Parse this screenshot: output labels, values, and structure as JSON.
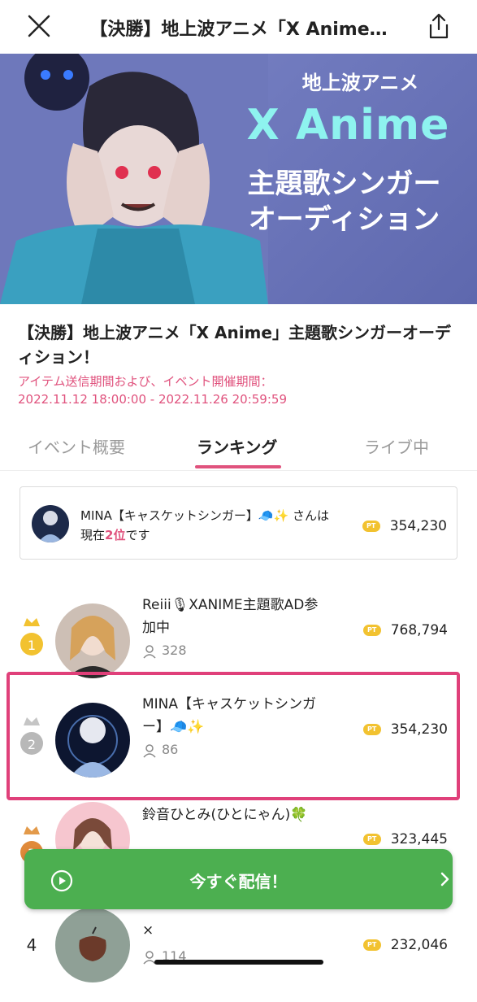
{
  "header": {
    "title": "【決勝】地上波アニメ「X Anime…"
  },
  "banner": {
    "line1": "地上波アニメ",
    "line2": "X Anime",
    "line3": "主題歌シンガー",
    "line4": "オーディション"
  },
  "event": {
    "title": "【決勝】地上波アニメ「X Anime」主題歌シンガーオーディション！",
    "period_label": "アイテム送信期間および、イベント開催期間：",
    "period_value": "2022.11.12 18:00:00 - 2022.11.26 20:59:59"
  },
  "tabs": [
    {
      "label": "イベント概要"
    },
    {
      "label": "ランキング"
    },
    {
      "label": "ライブ中"
    }
  ],
  "my_status": {
    "line1": "MINA【キャスケットシンガー】🧢✨ さんは",
    "line2_prefix": "現在",
    "rank": "2位",
    "line2_suffix": "です",
    "points": "354,230"
  },
  "pt_label": "PT",
  "ranking": [
    {
      "rank": "1",
      "name": "Reiii🎙XANIME主題歌AD参加中",
      "fans": "328",
      "points": "768,794",
      "medal": "gold"
    },
    {
      "rank": "2",
      "name": "MINA【キャスケットシンガー】🧢✨",
      "fans": "86",
      "points": "354,230",
      "medal": "silver"
    },
    {
      "rank": "3",
      "name": "鈴音ひとみ(ひとにゃん)🍀",
      "fans": "",
      "points": "323,445",
      "medal": "bronze"
    },
    {
      "rank": "4",
      "name": "×",
      "fans": "114",
      "points": "232,046",
      "medal": ""
    }
  ],
  "live_button": {
    "label": "今すぐ配信！"
  },
  "colors": {
    "accent": "#e0527d",
    "live_green": "#4caf50",
    "pt_yellow": "#f2c230"
  }
}
